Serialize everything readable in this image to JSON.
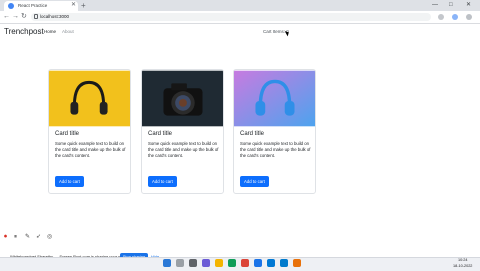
{
  "browser": {
    "tab_title": "React Practice",
    "new_tab": "+",
    "window_controls": [
      "—",
      "□",
      "✕"
    ],
    "address": "localhost:3000",
    "nav": {
      "back": "←",
      "forward": "→",
      "reload": "↻"
    }
  },
  "navbar": {
    "brand": "Trenchpost",
    "links": [
      {
        "label": "Home",
        "active": true
      },
      {
        "label": "About",
        "active": false
      }
    ],
    "cart_label": "Cart Items: 0"
  },
  "cards": [
    {
      "title": "Card title",
      "text": "Some quick example text to build on the card title and make up the bulk of the card's content.",
      "button": "Add to cart",
      "image": "headphones-yellow"
    },
    {
      "title": "Card title",
      "text": "Some quick example text to build on the card title and make up the bulk of the card's content.",
      "button": "Add to cart",
      "image": "camera-dark"
    },
    {
      "title": "Card title",
      "text": "Some quick example text to build on the card title and make up the bulk of the card's content.",
      "button": "Add to cart",
      "image": "headphones-blue"
    }
  ],
  "share_bar": {
    "text": "Whiteboardnet Sharethy — Screen Rust.com is sharing your screen.",
    "stop": "Stop sharing",
    "hide": "Hide"
  },
  "taskbar": {
    "time": "10:24",
    "date": "18-10-2022"
  },
  "colors": {
    "primary": "#0d6efd",
    "card_border": "#dfe2e6",
    "chrome_bg": "#dee1e6"
  }
}
